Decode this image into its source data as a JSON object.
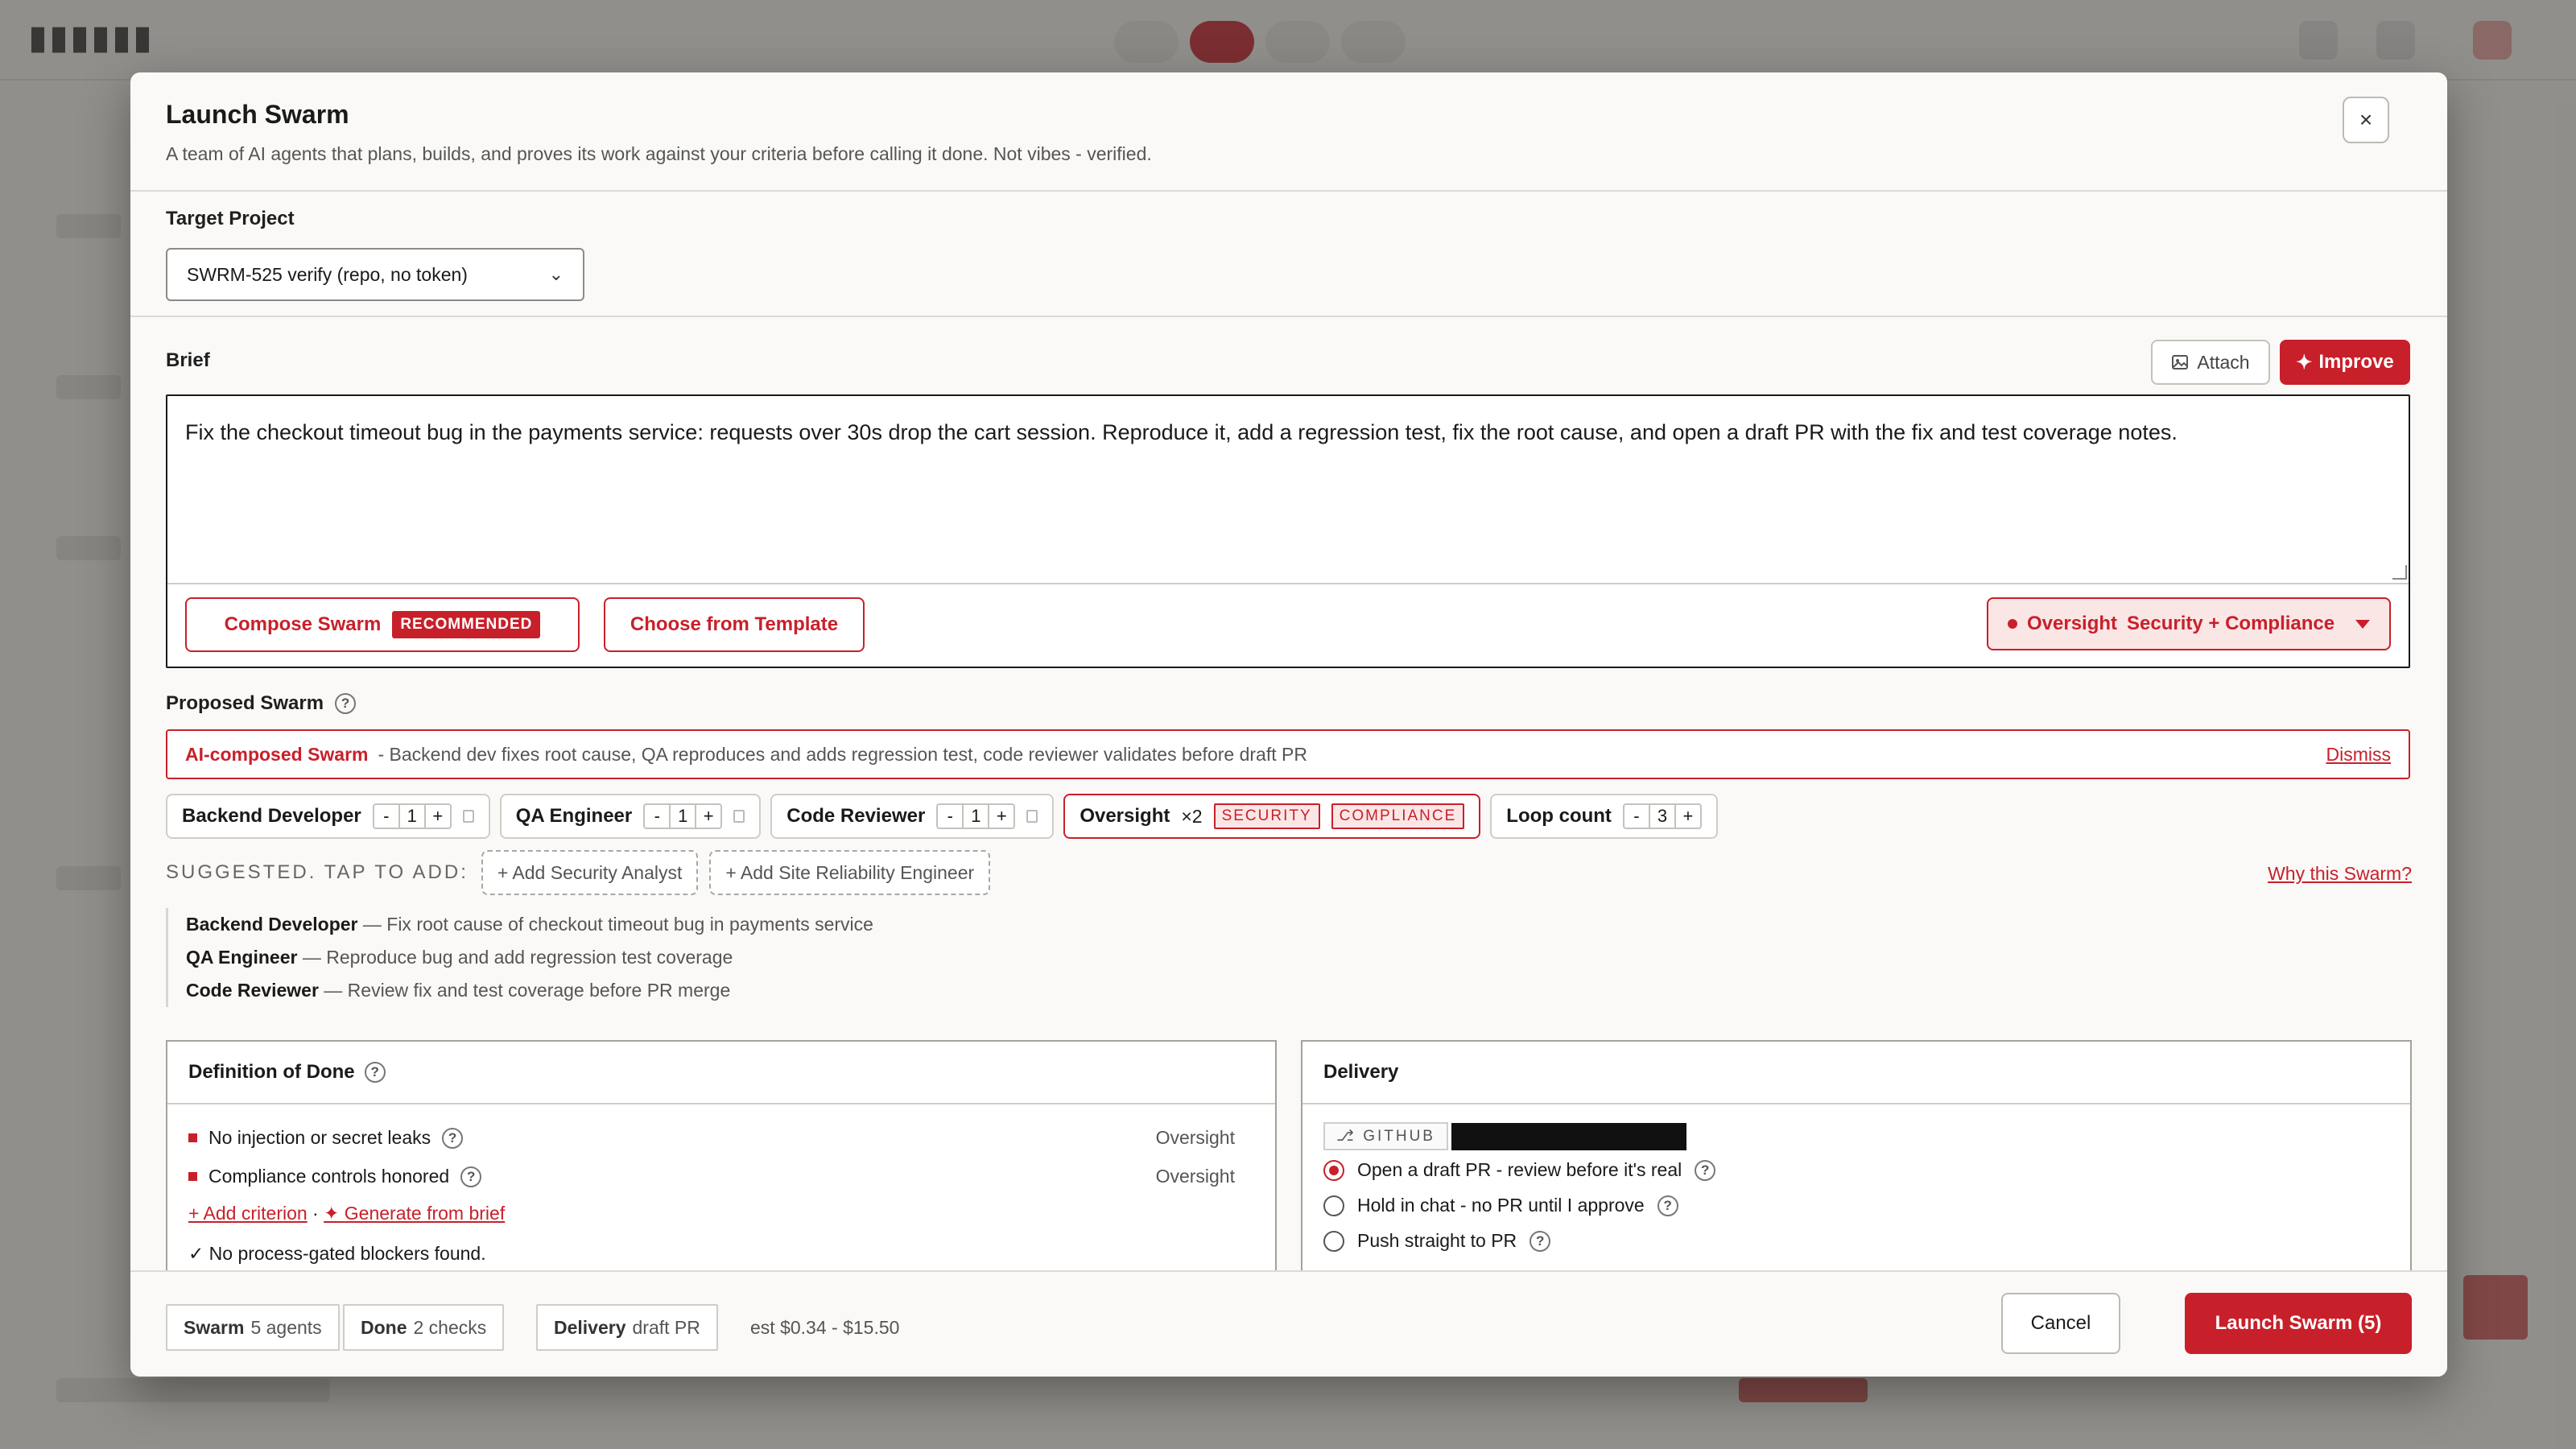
{
  "modal": {
    "title": "Launch Swarm",
    "subtitle": "A team of AI agents that plans, builds, and proves its work against your criteria before calling it done. Not vibes - verified.",
    "close_label": "×"
  },
  "target_project": {
    "label": "Target Project",
    "selected": "SWRM-525 verify (repo, no token)"
  },
  "brief": {
    "label": "Brief",
    "attach_label": "Attach",
    "improve_label": "Improve",
    "text": "Fix the checkout timeout bug in the payments service: requests over 30s drop the cart session. Reproduce it, add a regression test, fix the root cause, and open a draft PR with the fix and test coverage notes.",
    "compose_label": "Compose Swarm",
    "recommended_badge": "RECOMMENDED",
    "template_label": "Choose from Template",
    "oversight_label": "Oversight",
    "oversight_value": "Security + Compliance"
  },
  "proposed": {
    "label": "Proposed Swarm",
    "ai_title": "AI-composed Swarm",
    "ai_desc": "- Backend dev fixes root cause, QA reproduces and adds regression test, code reviewer validates before draft PR",
    "dismiss_label": "Dismiss",
    "roles": [
      {
        "name": "Backend Developer",
        "count": "1"
      },
      {
        "name": "QA Engineer",
        "count": "1"
      },
      {
        "name": "Code Reviewer",
        "count": "1"
      }
    ],
    "oversight": {
      "name": "Oversight",
      "mult": "×2",
      "tags": [
        "SECURITY",
        "COMPLIANCE"
      ]
    },
    "loop": {
      "name": "Loop count",
      "count": "3"
    },
    "suggest_label": "SUGGESTED. TAP TO ADD:",
    "suggestions": [
      "+ Add Security Analyst",
      "+ Add Site Reliability Engineer"
    ],
    "why_label": "Why this Swarm?",
    "assignments": [
      {
        "role": "Backend Developer",
        "task": " — Fix root cause of checkout timeout bug in payments service"
      },
      {
        "role": "QA Engineer",
        "task": " — Reproduce bug and add regression test coverage"
      },
      {
        "role": "Code Reviewer",
        "task": " — Review fix and test coverage before PR merge"
      }
    ]
  },
  "dod": {
    "title": "Definition of Done",
    "criteria": [
      {
        "text": "No injection or secret leaks",
        "source": "Oversight"
      },
      {
        "text": "Compliance controls honored",
        "source": "Oversight"
      }
    ],
    "add_label": "+ Add criterion",
    "sep": " · ",
    "generate_label": "Generate from brief",
    "blockers": "No process-gated blockers found."
  },
  "delivery": {
    "title": "Delivery",
    "github_tag": "GITHUB",
    "options": [
      {
        "label": "Open a draft PR - review before it's real",
        "selected": true
      },
      {
        "label": "Hold in chat - no PR until I approve",
        "selected": false
      },
      {
        "label": "Push straight to PR",
        "selected": false
      }
    ]
  },
  "footer": {
    "swarm_label": "Swarm",
    "swarm_value": "5 agents",
    "done_label": "Done",
    "done_value": "2 checks",
    "delivery_label": "Delivery",
    "delivery_value": "draft PR",
    "estimate": "est $0.34 - $15.50",
    "cancel_label": "Cancel",
    "launch_label": "Launch Swarm (5)"
  },
  "colors": {
    "accent": "#c8202a",
    "accent_tint": "#fbe6e6"
  }
}
